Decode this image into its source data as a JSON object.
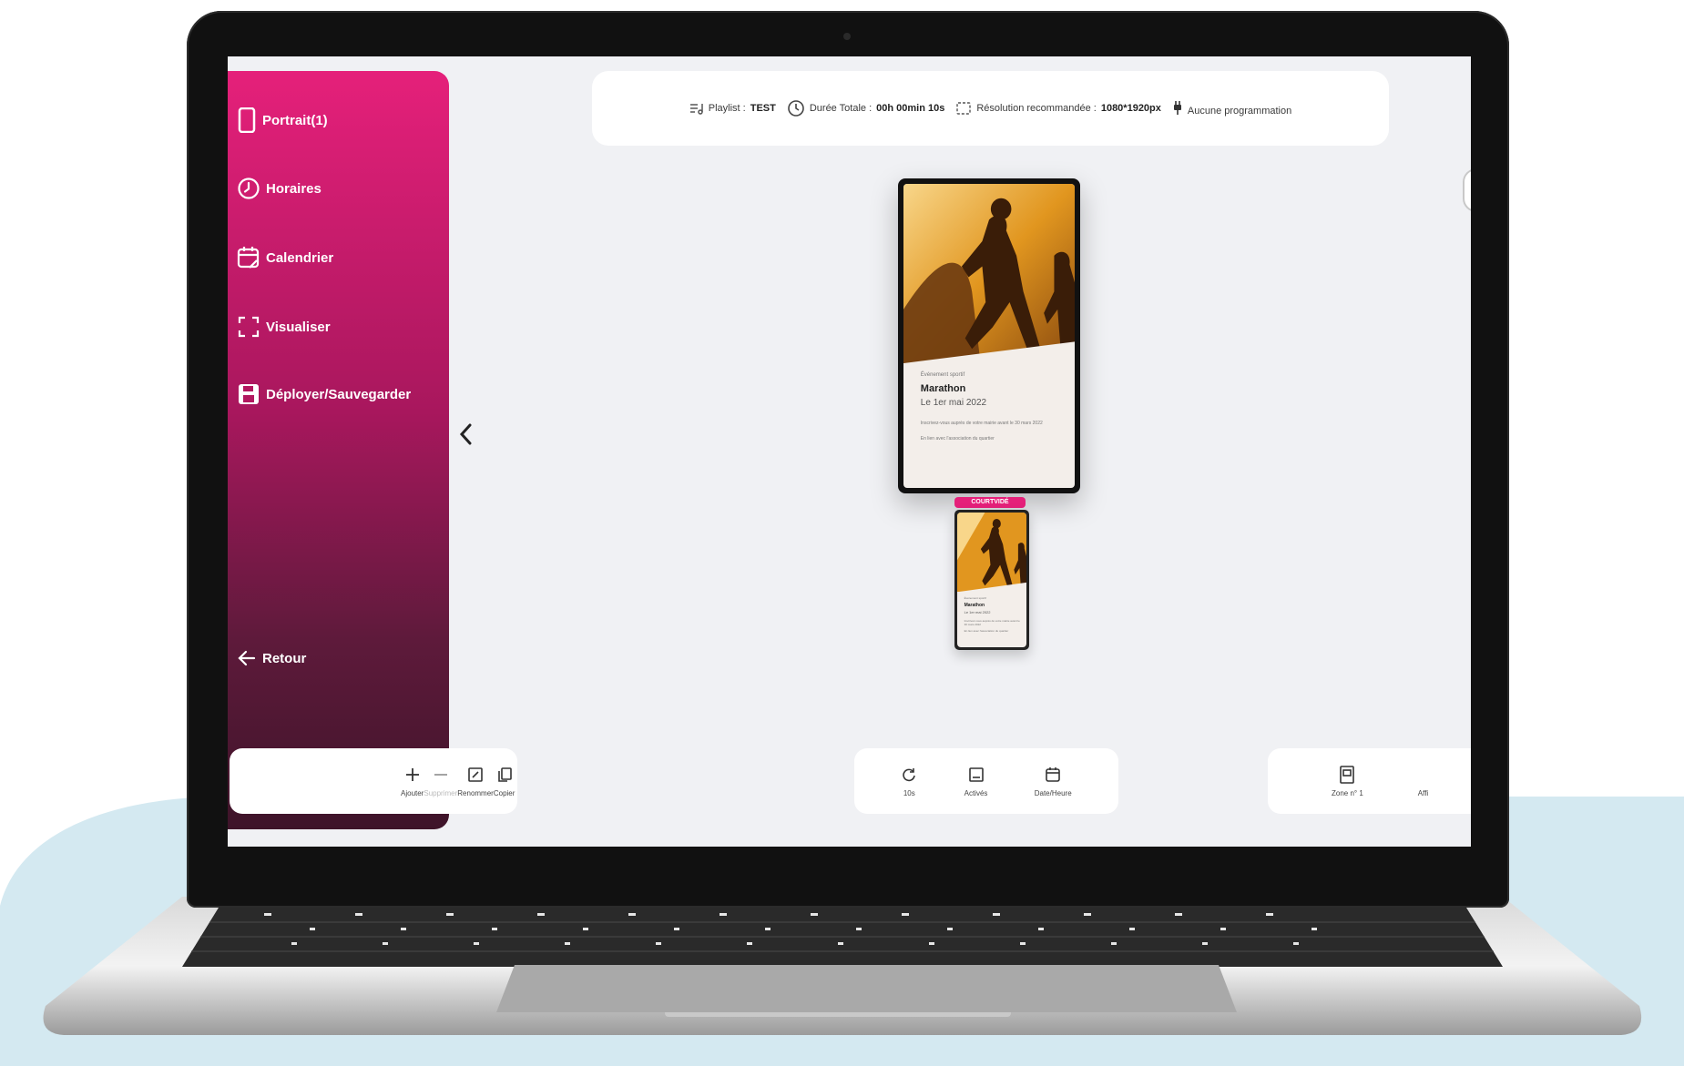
{
  "sidebar": {
    "items": [
      {
        "label": "Portrait(1)",
        "icon": "phone-portrait-icon"
      },
      {
        "label": "Horaires",
        "icon": "clock-icon"
      },
      {
        "label": "Calendrier",
        "icon": "calendar-edit-icon"
      },
      {
        "label": "Visualiser",
        "icon": "fullscreen-icon"
      },
      {
        "label": "Déployer/Sauvegarder",
        "icon": "save-icon"
      }
    ],
    "back_label": "Retour",
    "gradient": [
      "#e5207a",
      "#3e1429"
    ]
  },
  "infobar": {
    "playlist_label": "Playlist :",
    "playlist_value": "TEST",
    "duration_label": "Durée Totale :",
    "duration_value": "00h 00min 10s",
    "resolution_label": "Résolution recommandée :",
    "resolution_value": "1080*1920px",
    "schedule_text": "Aucune programmation"
  },
  "preview": {
    "category": "Événement sportif",
    "title": "Marathon",
    "date": "Le 1er mai 2022",
    "body": "Inscrivez-vous auprès de votre mairie avant le 30 mars 2022",
    "footer": "En lien avec l'association du quartier"
  },
  "thumbnail": {
    "tag": "COURTVIDÉ"
  },
  "toolbar_left": {
    "add": "Ajouter",
    "delete": "Supprimer",
    "rename": "Renommer",
    "copy": "Copier"
  },
  "toolbar_center": {
    "duration": "10s",
    "activated": "Activés",
    "datetime": "Date/Heure"
  },
  "toolbar_right": {
    "zone": "Zone n°  1",
    "display_partial": "Affi"
  },
  "colors": {
    "accent": "#e5207a",
    "screen_bg": "#f0f1f4",
    "background_blob": "#d4e9f1"
  }
}
